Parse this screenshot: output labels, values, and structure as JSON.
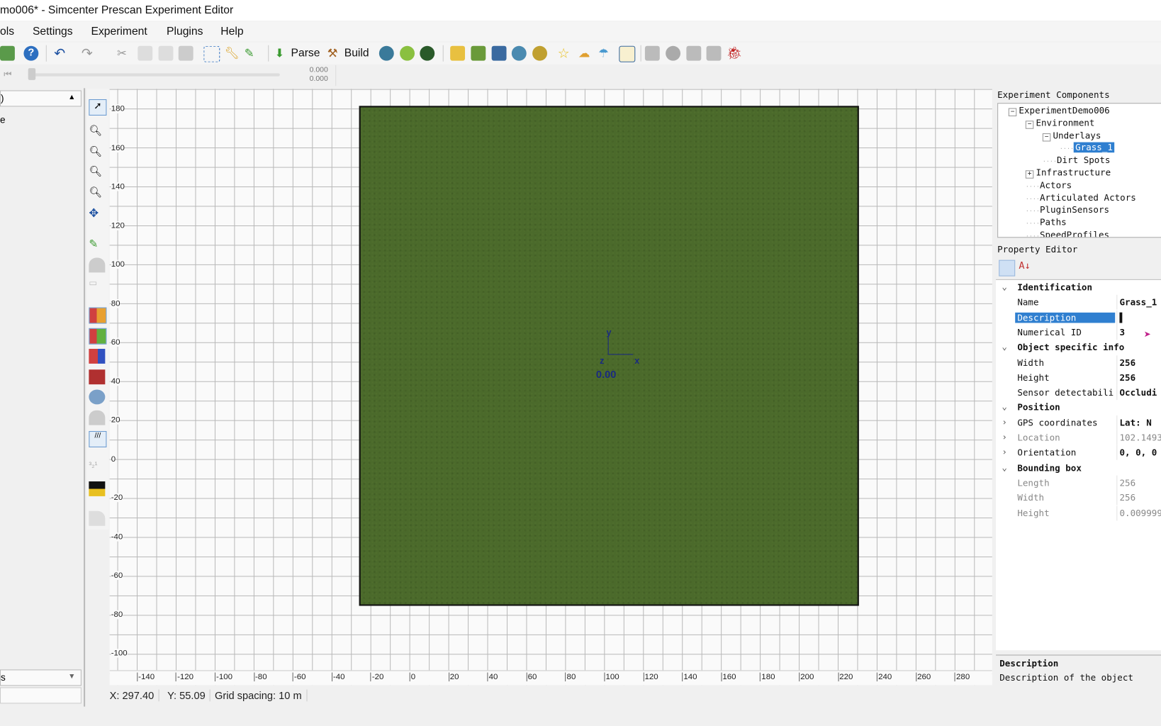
{
  "window": {
    "title": "mo006* - Simcenter Prescan Experiment Editor"
  },
  "menu": [
    "ols",
    "Settings",
    "Experiment",
    "Plugins",
    "Help"
  ],
  "toolbar": {
    "parse": "Parse",
    "build": "Build"
  },
  "slider": {
    "value_top": "0.000",
    "value_bottom": "0.000",
    "position": 0
  },
  "left_panel": {
    "top_combo": ")",
    "item": "e",
    "bottom_combo": "s"
  },
  "canvas": {
    "y_ticks": [
      "180",
      "160",
      "140",
      "120",
      "100",
      "80",
      "60",
      "40",
      "20",
      "0",
      "-20",
      "-40",
      "-60",
      "-80",
      "-100"
    ],
    "x_ticks": [
      "-140",
      "-120",
      "-100",
      "-80",
      "-60",
      "-40",
      "-20",
      "0",
      "20",
      "40",
      "60",
      "80",
      "100",
      "120",
      "140",
      "160",
      "180",
      "200",
      "220",
      "240",
      "260",
      "280"
    ],
    "origin_label": "0.00",
    "axis_x": "x",
    "axis_y": "y",
    "axis_z": "z",
    "grass_color": "#4b6a2b"
  },
  "status": {
    "x": "X: 297.40",
    "y": "Y: 55.09",
    "grid": "Grid spacing: 10 m"
  },
  "components": {
    "title": "Experiment Components",
    "tree": [
      {
        "label": "ExperimentDemo006",
        "level": 0,
        "expander": "−"
      },
      {
        "label": "Environment",
        "level": 1,
        "expander": "−"
      },
      {
        "label": "Underlays",
        "level": 2,
        "expander": "−"
      },
      {
        "label": "Grass_1",
        "level": 3,
        "selected": true
      },
      {
        "label": "Dirt Spots",
        "level": 2
      },
      {
        "label": "Infrastructure",
        "level": 1,
        "expander": "+"
      },
      {
        "label": "Actors",
        "level": 1
      },
      {
        "label": "Articulated Actors",
        "level": 1
      },
      {
        "label": "PluginSensors",
        "level": 1
      },
      {
        "label": "Paths",
        "level": 1
      },
      {
        "label": "SpeedProfiles",
        "level": 1
      }
    ]
  },
  "property_editor": {
    "title": "Property Editor",
    "rows": [
      {
        "type": "cat",
        "name": "Identification"
      },
      {
        "name": "Name",
        "value": "Grass_1",
        "bold": true
      },
      {
        "name": "Description",
        "value": "▌",
        "selected": true
      },
      {
        "name": "Numerical ID",
        "value": "3",
        "bold": true
      },
      {
        "type": "cat",
        "name": "Object specific info"
      },
      {
        "name": "Width",
        "value": "256",
        "bold": true
      },
      {
        "name": "Height",
        "value": "256",
        "bold": true
      },
      {
        "name": "Sensor detectabili",
        "value": "Occludi",
        "bold": true
      },
      {
        "type": "cat",
        "name": "Position"
      },
      {
        "name": "GPS coordinates",
        "value": "Lat: N",
        "bold": true,
        "expand": true
      },
      {
        "name": "Location",
        "value": "102.1493",
        "grey": true,
        "expand": true
      },
      {
        "name": "Orientation",
        "value": "0, 0, 0",
        "bold": true,
        "expand": true
      },
      {
        "type": "cat",
        "name": "Bounding box"
      },
      {
        "name": "Length",
        "value": "256",
        "grey": true
      },
      {
        "name": "Width",
        "value": "256",
        "grey": true
      },
      {
        "name": "Height",
        "value": "0.009999",
        "grey": true
      }
    ],
    "help_title": "Description",
    "help_text": "Description of the object"
  }
}
